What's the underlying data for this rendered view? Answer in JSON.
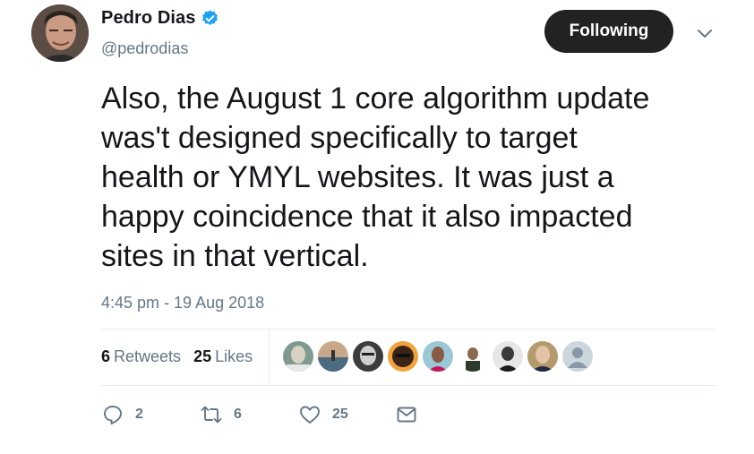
{
  "author": {
    "display_name": "Pedro Dias",
    "handle": "@pedrodias",
    "verified": true
  },
  "follow_button": {
    "label": "Following"
  },
  "tweet": {
    "text": "Also, the August 1 core algorithm update\nwas't designed specifically to target\nhealth or YMYL websites. It was just a\nhappy coincidence that it also impacted\nsites in that vertical.",
    "timestamp": "4:45 pm - 19 Aug 2018"
  },
  "stats": {
    "retweets_count": "6",
    "retweets_label": "Retweets",
    "likes_count": "25",
    "likes_label": "Likes"
  },
  "actions": {
    "reply_count": "2",
    "retweet_count": "6",
    "like_count": "25"
  },
  "colors": {
    "verified": "#1da1f2",
    "follow_bg": "#222222",
    "muted": "#657786",
    "divider": "#e6ecf0"
  },
  "icons": {
    "verified": "verified-badge-icon",
    "menu": "chevron-down-icon",
    "reply": "reply-icon",
    "retweet": "retweet-icon",
    "like": "heart-icon",
    "dm": "envelope-icon"
  }
}
